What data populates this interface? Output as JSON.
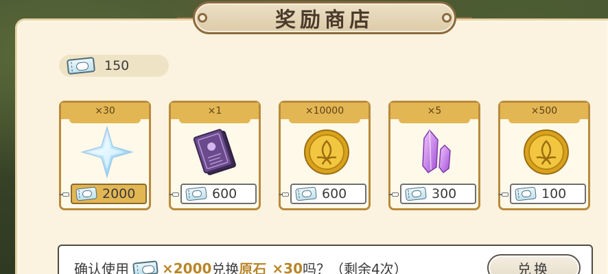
{
  "title": "奖励商店",
  "currency": {
    "icon": "ticket-icon",
    "amount": "150"
  },
  "items": [
    {
      "qty": "×30",
      "icon": "primogem-icon",
      "price": "2000",
      "selected": true
    },
    {
      "qty": "×1",
      "icon": "book-icon",
      "price": "600",
      "selected": false
    },
    {
      "qty": "×10000",
      "icon": "mora-coin-icon",
      "price": "600",
      "selected": false
    },
    {
      "qty": "×5",
      "icon": "crystal-icon",
      "price": "300",
      "selected": false
    },
    {
      "qty": "×500",
      "icon": "mora-coin-icon",
      "price": "100",
      "selected": false
    }
  ],
  "confirm": {
    "prefix": "确认使用",
    "cost": "×2000",
    "mid": "兑换",
    "item_name": "原石",
    "item_qty": "×30",
    "suffix": "吗？（剩余4次）",
    "button_label": "兑换"
  },
  "colors": {
    "accent_gold": "#e3b654",
    "panel_bg": "#fbf3df",
    "card_border": "#b88a3a"
  }
}
